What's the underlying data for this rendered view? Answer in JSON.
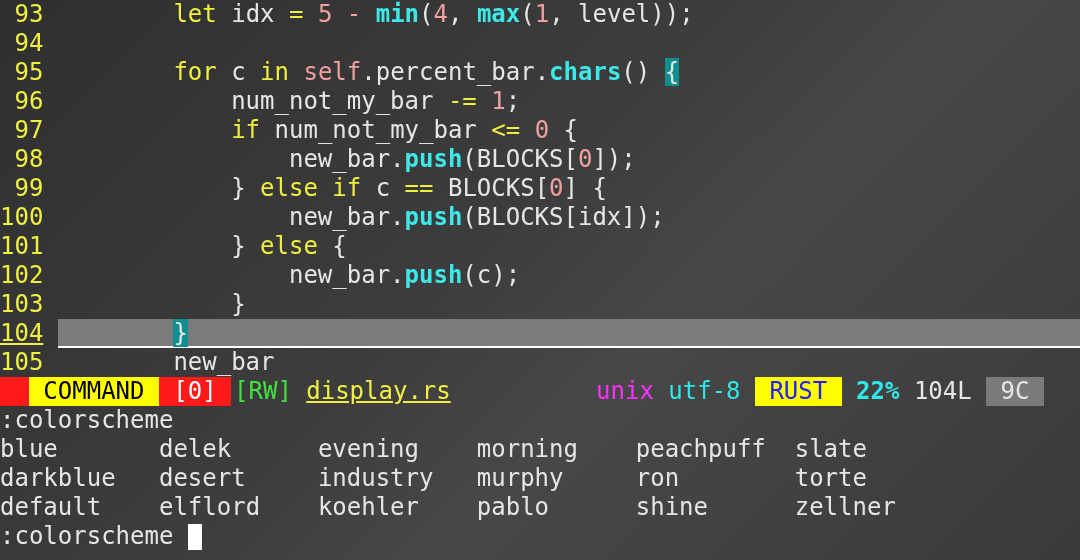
{
  "editor": {
    "lines": [
      {
        "number": "93",
        "current": false,
        "tokens": [
          {
            "kind": "keyword",
            "text": "        let"
          },
          {
            "kind": "plain",
            "text": " idx "
          },
          {
            "kind": "keyword",
            "text": "="
          },
          {
            "kind": "number",
            "text": " 5"
          },
          {
            "kind": "number",
            "text": " -"
          },
          {
            "kind": "function",
            "text": " min"
          },
          {
            "kind": "plain",
            "text": "("
          },
          {
            "kind": "number",
            "text": "4"
          },
          {
            "kind": "plain",
            "text": ", "
          },
          {
            "kind": "function",
            "text": "max"
          },
          {
            "kind": "plain",
            "text": "("
          },
          {
            "kind": "number",
            "text": "1"
          },
          {
            "kind": "plain",
            "text": ", level));"
          }
        ]
      },
      {
        "number": "94",
        "current": false
      },
      {
        "number": "95",
        "current": false,
        "tokens": [
          {
            "kind": "keyword",
            "text": "        for"
          },
          {
            "kind": "plain",
            "text": " c "
          },
          {
            "kind": "keyword",
            "text": "in"
          },
          {
            "kind": "number",
            "text": " self"
          },
          {
            "kind": "plain",
            "text": ".percent_bar."
          },
          {
            "kind": "function",
            "text": "chars"
          },
          {
            "kind": "plain",
            "text": "() "
          },
          {
            "kind": "match",
            "text": "{"
          }
        ]
      },
      {
        "number": "96",
        "current": false,
        "tokens": [
          {
            "kind": "plain",
            "text": "            num_not_my_bar "
          },
          {
            "kind": "keyword",
            "text": "-="
          },
          {
            "kind": "number",
            "text": " 1"
          },
          {
            "kind": "plain",
            "text": ";"
          }
        ]
      },
      {
        "number": "97",
        "current": false,
        "tokens": [
          {
            "kind": "keyword",
            "text": "            if"
          },
          {
            "kind": "plain",
            "text": " num_not_my_bar "
          },
          {
            "kind": "keyword",
            "text": "<="
          },
          {
            "kind": "number",
            "text": " 0"
          },
          {
            "kind": "plain",
            "text": " {"
          }
        ]
      },
      {
        "number": "98",
        "current": false,
        "tokens": [
          {
            "kind": "plain",
            "text": "                new_bar."
          },
          {
            "kind": "function",
            "text": "push"
          },
          {
            "kind": "plain",
            "text": "(BLOCKS["
          },
          {
            "kind": "number",
            "text": "0"
          },
          {
            "kind": "plain",
            "text": "]);"
          }
        ]
      },
      {
        "number": "99",
        "current": false,
        "tokens": [
          {
            "kind": "plain",
            "text": "            } "
          },
          {
            "kind": "keyword",
            "text": "else if"
          },
          {
            "kind": "plain",
            "text": " c "
          },
          {
            "kind": "keyword",
            "text": "=="
          },
          {
            "kind": "plain",
            "text": " BLOCKS["
          },
          {
            "kind": "number",
            "text": "0"
          },
          {
            "kind": "plain",
            "text": "] {"
          }
        ]
      },
      {
        "number": "100",
        "current": false,
        "tokens": [
          {
            "kind": "plain",
            "text": "                new_bar."
          },
          {
            "kind": "function",
            "text": "push"
          },
          {
            "kind": "plain",
            "text": "(BLOCKS[idx]);"
          }
        ]
      },
      {
        "number": "101",
        "current": false,
        "tokens": [
          {
            "kind": "plain",
            "text": "            } "
          },
          {
            "kind": "keyword",
            "text": "else"
          },
          {
            "kind": "plain",
            "text": " {"
          }
        ]
      },
      {
        "number": "102",
        "current": false,
        "tokens": [
          {
            "kind": "plain",
            "text": "                new_bar."
          },
          {
            "kind": "function",
            "text": "push"
          },
          {
            "kind": "plain",
            "text": "(c);"
          }
        ]
      },
      {
        "number": "103",
        "current": false,
        "tokens": [
          {
            "kind": "plain",
            "text": "            }"
          }
        ]
      },
      {
        "number": "104",
        "current": true,
        "tokens": [
          {
            "kind": "match",
            "text": "        }"
          }
        ]
      },
      {
        "number": "105",
        "current": false,
        "tokens": [
          {
            "kind": "plain",
            "text": "        new_bar"
          }
        ]
      }
    ]
  },
  "status_bar": {
    "mode": "COMMAND",
    "buffer": "[0]",
    "access": "[RW]",
    "file": "display.rs",
    "fileformat": "unix",
    "encoding": "utf-8",
    "filetype": "RUST",
    "percent": "22%",
    "line": "104L",
    "column": "9C"
  },
  "command_line": {
    "echo": ":colorscheme",
    "completions": [
      "blue",
      "darkblue",
      "default",
      "delek",
      "desert",
      "elflord",
      "evening",
      "industry",
      "koehler",
      "morning",
      "murphy",
      "pablo",
      "peachpuff",
      "ron",
      "shine",
      "slate",
      "torte",
      "zellner"
    ],
    "input": ":colorscheme"
  }
}
